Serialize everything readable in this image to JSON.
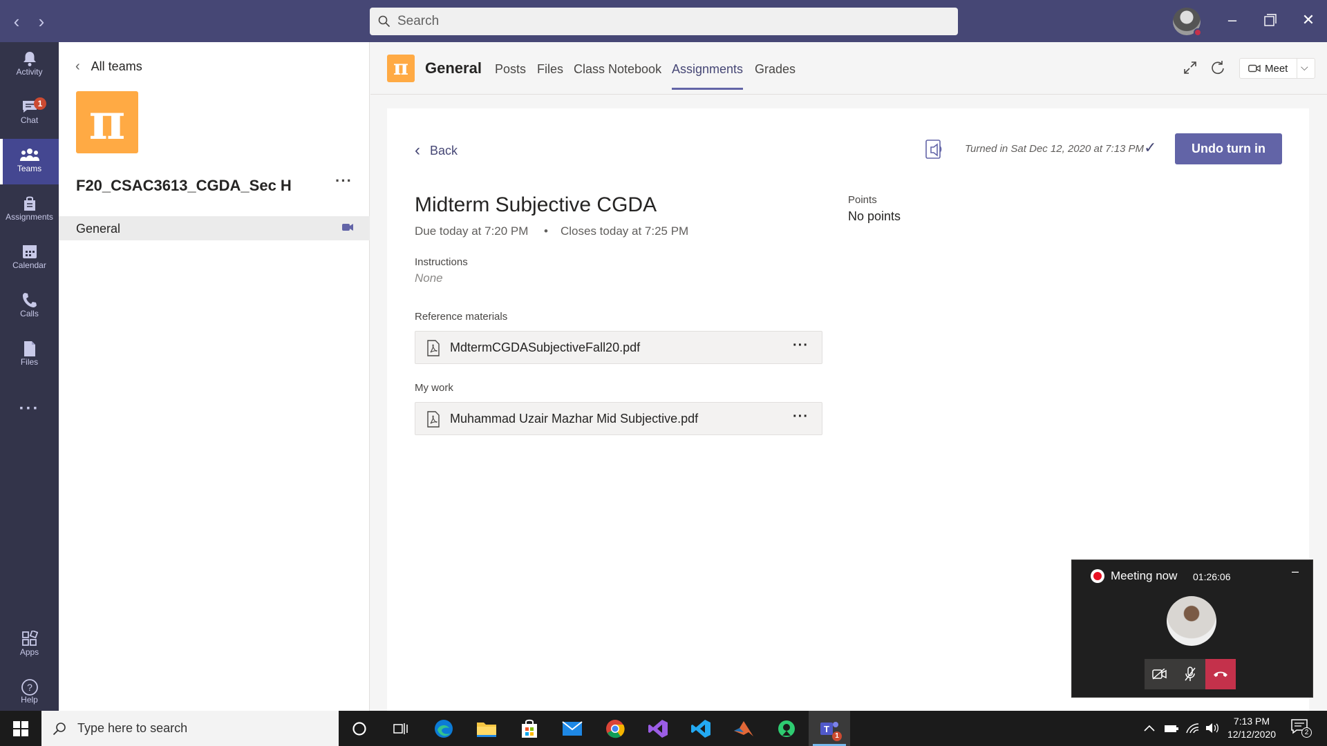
{
  "titlebar": {
    "search_placeholder": "Search"
  },
  "rail": {
    "items": [
      {
        "label": "Activity",
        "icon": "bell-icon"
      },
      {
        "label": "Chat",
        "icon": "chat-icon",
        "badge": "1"
      },
      {
        "label": "Teams",
        "icon": "teams-icon",
        "active": true
      },
      {
        "label": "Assignments",
        "icon": "assignments-icon"
      },
      {
        "label": "Calendar",
        "icon": "calendar-icon"
      },
      {
        "label": "Calls",
        "icon": "phone-icon"
      },
      {
        "label": "Files",
        "icon": "file-icon"
      },
      {
        "label": "Apps",
        "icon": "apps-icon"
      },
      {
        "label": "Help",
        "icon": "help-icon"
      }
    ]
  },
  "team_panel": {
    "back_label": "All teams",
    "team_name": "F20_CSAC3613_CGDA_Sec H",
    "team_logo_glyph": "π",
    "channels": [
      {
        "label": "General"
      }
    ]
  },
  "channel_header": {
    "logo_glyph": "π",
    "title": "General",
    "tabs": [
      "Posts",
      "Files",
      "Class Notebook",
      "Assignments",
      "Grades"
    ],
    "active_tab": "Assignments",
    "meet_label": "Meet"
  },
  "assignment": {
    "back_label": "Back",
    "turned_in_text": "Turned in Sat Dec 12, 2020 at 7:13 PM",
    "undo_label": "Undo turn in",
    "title": "Midterm Subjective CGDA",
    "due": "Due today at 7:20 PM",
    "bullet": "•",
    "closes": "Closes today at 7:25 PM",
    "instructions_label": "Instructions",
    "instructions_value": "None",
    "points_label": "Points",
    "points_value": "No points",
    "reference_label": "Reference materials",
    "reference_files": [
      "MdtermCGDASubjectiveFall20.pdf"
    ],
    "my_work_label": "My work",
    "my_work_files": [
      "Muhammad Uzair Mazhar Mid Subjective.pdf"
    ]
  },
  "meeting": {
    "title": "Meeting now",
    "timer": "01:26:06"
  },
  "taskbar": {
    "search_placeholder": "Type here to search",
    "time": "7:13 PM",
    "date": "12/12/2020",
    "notification_count": "2",
    "teams_badge": "1"
  },
  "colors": {
    "brand": "#464775",
    "accent": "#6264a7",
    "team_logo": "#ffaa44",
    "rail": "#33344a"
  }
}
